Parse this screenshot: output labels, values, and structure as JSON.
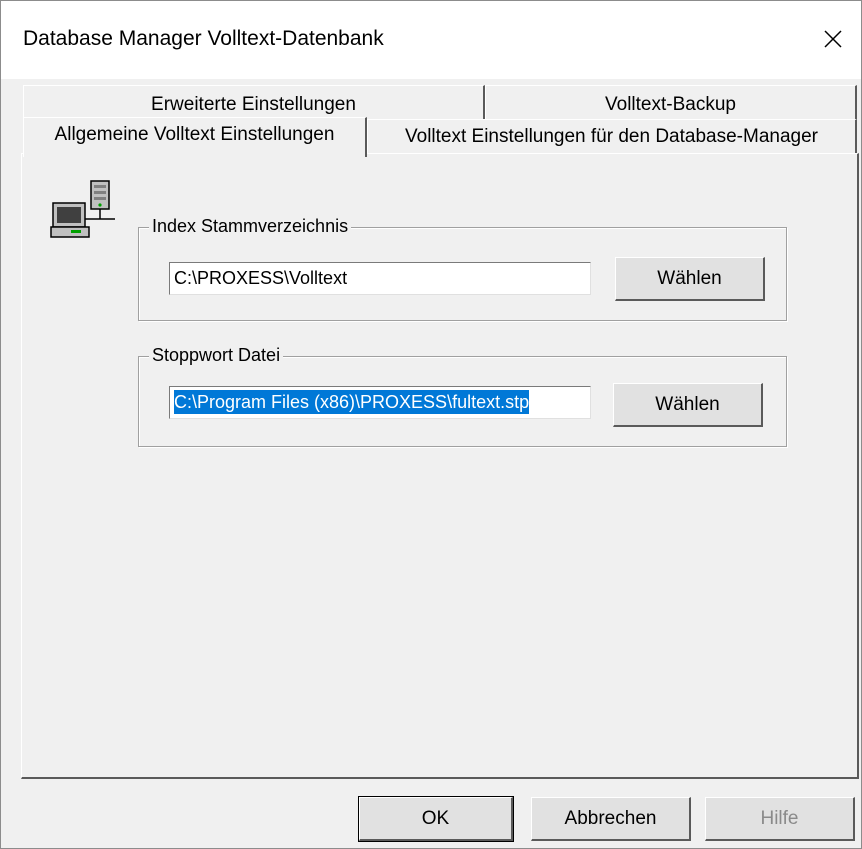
{
  "window": {
    "title": "Database Manager Volltext-Datenbank",
    "close_icon": "close-icon"
  },
  "tabs": {
    "row_back": [
      {
        "label": "Erweiterte Einstellungen"
      },
      {
        "label": "Volltext-Backup"
      }
    ],
    "row_front": [
      {
        "label": "Allgemeine Volltext Einstellungen",
        "active": true
      },
      {
        "label": "Volltext Einstellungen für den Database-Manager"
      }
    ]
  },
  "panel": {
    "icon": "network-computer-icon",
    "index_group": {
      "label": "Index Stammverzeichnis",
      "value": "C:\\PROXESS\\Volltext",
      "button_label": "Wählen"
    },
    "stop_group": {
      "label": "Stoppwort Datei",
      "value": "C:\\Program Files (x86)\\PROXESS\\fultext.stp",
      "button_label": "Wählen"
    }
  },
  "footer": {
    "ok_label": "OK",
    "cancel_label": "Abbrechen",
    "help_label": "Hilfe"
  },
  "colors": {
    "selection": "#0078d7",
    "dialog_bg": "#f0f0f0"
  }
}
